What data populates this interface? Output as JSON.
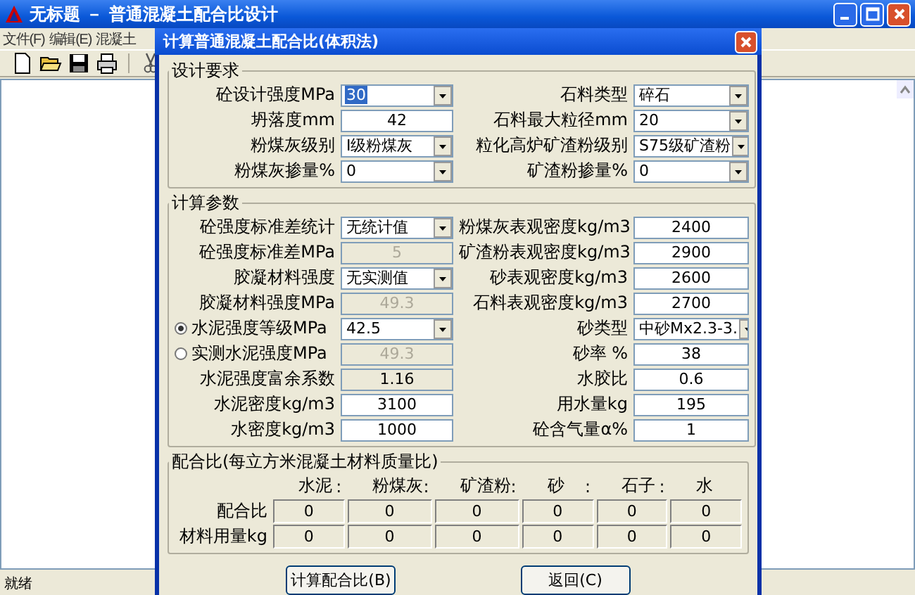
{
  "window": {
    "title": "无标题 － 普通混凝土配合比设计"
  },
  "menu": [
    "文件(F)",
    "编辑(E)",
    "混凝土"
  ],
  "status_bar": "就绪",
  "dialog": {
    "title": "计算普通混凝土配合比(体积法)",
    "design": {
      "title": "设计要求",
      "fields": [
        {
          "label": "砼设计强度MPa",
          "value": "30",
          "kind": "combo",
          "highlighted": true
        },
        {
          "label": "石料类型",
          "value": "碎石",
          "kind": "combo",
          "highlighted": false
        },
        {
          "label": "坍落度mm",
          "value": "42",
          "kind": "text",
          "highlighted": false
        },
        {
          "label": "石料最大粒径mm",
          "value": "20",
          "kind": "combo",
          "highlighted": false
        },
        {
          "label": "粉煤灰级别",
          "value": "Ⅰ级粉煤灰",
          "kind": "combo",
          "highlighted": false
        },
        {
          "label": "粒化高炉矿渣粉级别",
          "value": "S75级矿渣粉",
          "kind": "combo",
          "highlighted": false
        },
        {
          "label": "粉煤灰掺量%",
          "value": "0",
          "kind": "combo",
          "highlighted": false
        },
        {
          "label": "矿渣粉掺量%",
          "value": "0",
          "kind": "combo",
          "highlighted": false
        }
      ]
    },
    "params": {
      "title": "计算参数",
      "fields": [
        {
          "label": "砼强度标准差统计",
          "value": "无统计值",
          "kind": "combo"
        },
        {
          "label": "粉煤灰表观密度kg/m3",
          "value": "2400",
          "kind": "text"
        },
        {
          "label": "砼强度标准差MPa",
          "value": "5",
          "kind": "disabled"
        },
        {
          "label": "矿渣粉表观密度kg/m3",
          "value": "2900",
          "kind": "text"
        },
        {
          "label": "胶凝材料强度",
          "value": "无实测值",
          "kind": "combo"
        },
        {
          "label": "砂表观密度kg/m3",
          "value": "2600",
          "kind": "text"
        },
        {
          "label": "胶凝材料强度MPa",
          "value": "49.3",
          "kind": "disabled"
        },
        {
          "label": "石料表观密度kg/m3",
          "value": "2700",
          "kind": "text"
        },
        {
          "label": "水泥强度等级MPa",
          "value": "42.5",
          "kind": "radio-combo",
          "selected": true
        },
        {
          "label": "砂类型",
          "value": "中砂Mx2.3-3.",
          "kind": "combo"
        },
        {
          "label": "实测水泥强度MPa",
          "value": "49.3",
          "kind": "radio-disabled",
          "selected": false
        },
        {
          "label": "砂率 %",
          "value": "38",
          "kind": "text"
        },
        {
          "label": "水泥强度富余系数",
          "value": "1.16",
          "kind": "readonly"
        },
        {
          "label": "水胶比",
          "value": "0.6",
          "kind": "text"
        },
        {
          "label": "水泥密度kg/m3",
          "value": "3100",
          "kind": "text"
        },
        {
          "label": "用水量kg",
          "value": "195",
          "kind": "text"
        },
        {
          "label": "水密度kg/m3",
          "value": "1000",
          "kind": "text"
        },
        {
          "label": "砼含气量α%",
          "value": "1",
          "kind": "text"
        }
      ]
    },
    "ratio": {
      "title": "配合比(每立方米混凝土材料质量比)",
      "columns": [
        "水泥",
        "粉煤灰",
        "矿渣粉",
        "砂",
        "石子",
        "水"
      ],
      "separators": [
        ":",
        ":",
        ":",
        ":",
        ":"
      ],
      "rows": [
        {
          "label": "配合比",
          "cells": [
            "0",
            "0",
            "0",
            "0",
            "0",
            "0"
          ]
        },
        {
          "label": "材料用量kg",
          "cells": [
            "0",
            "0",
            "0",
            "0",
            "0",
            "0"
          ]
        }
      ]
    },
    "buttons": [
      "计算配合比(B)",
      "返回(C)"
    ]
  }
}
